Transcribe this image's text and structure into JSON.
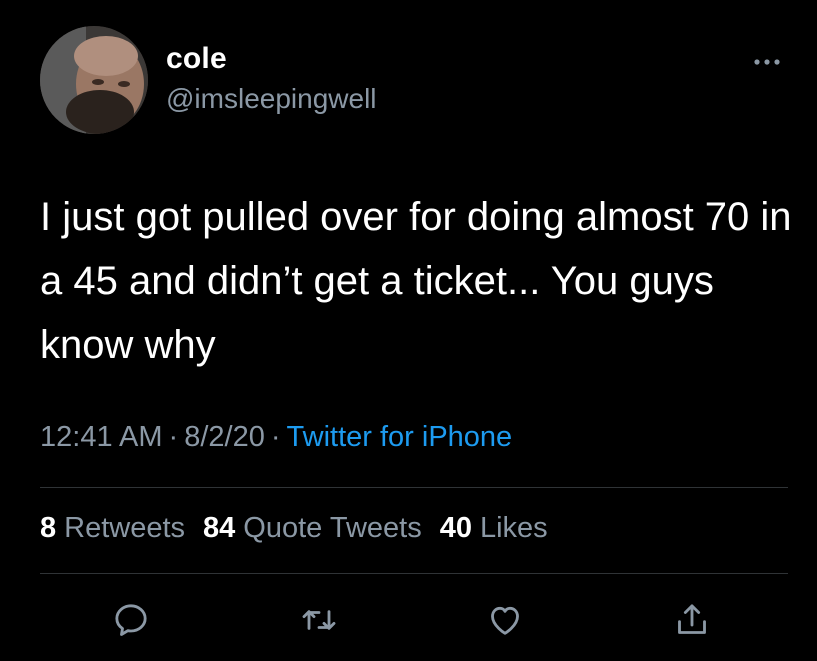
{
  "user": {
    "display_name": "cole",
    "handle": "@imsleepingwell",
    "avatar": "profile-photo"
  },
  "tweet": {
    "text": "I just got pulled over for doing almost 70 in a 45 and didn’t get a ticket... You guys know why",
    "time": "12:41 AM",
    "date": "8/2/20",
    "separator": "·",
    "source": "Twitter for iPhone"
  },
  "stats": {
    "retweets": {
      "count": "8",
      "label": "Retweets"
    },
    "quote_tweets": {
      "count": "84",
      "label": "Quote Tweets"
    },
    "likes": {
      "count": "40",
      "label": "Likes"
    }
  },
  "actions": {
    "reply": "reply-icon",
    "retweet": "retweet-icon",
    "like": "heart-icon",
    "share": "share-icon",
    "more": "more-icon"
  },
  "colors": {
    "background": "#000000",
    "text": "#ffffff",
    "secondary": "#8b98a5",
    "link": "#1d9bf0",
    "divider": "#2f3336"
  }
}
